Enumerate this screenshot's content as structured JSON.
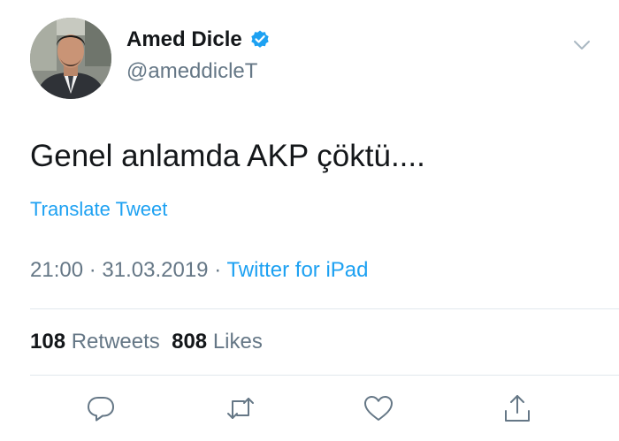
{
  "author": {
    "display_name": "Amed Dicle",
    "handle": "@ameddicleT",
    "verified": true
  },
  "tweet": {
    "text": "Genel anlamda AKP çöktü....",
    "translate_label": "Translate Tweet",
    "time": "21:00",
    "date": "31.03.2019",
    "separator": "·",
    "source": "Twitter for iPad"
  },
  "stats": {
    "retweets_count": "108",
    "retweets_label": "Retweets",
    "likes_count": "808",
    "likes_label": "Likes"
  },
  "icons": {
    "menu": "chevron-down-icon",
    "verified": "verified-badge-icon",
    "reply": "reply-icon",
    "retweet": "retweet-icon",
    "like": "heart-icon",
    "share": "share-icon"
  },
  "colors": {
    "accent": "#1da1f2",
    "text": "#14171a",
    "secondary": "#657786",
    "divider": "#e1e8ed"
  }
}
